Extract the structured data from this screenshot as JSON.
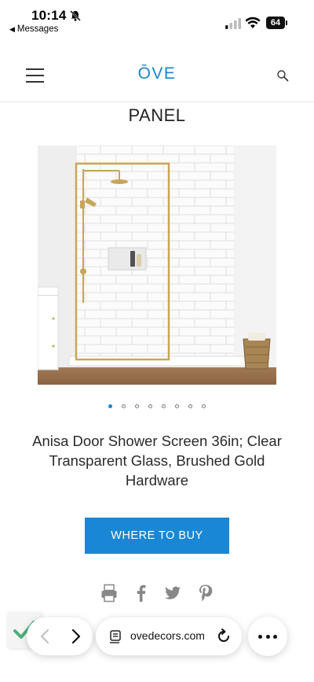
{
  "status_bar": {
    "time": "10:14",
    "back_app": "Messages",
    "battery": "64"
  },
  "header": {
    "logo": "ŌVE"
  },
  "page_title": "PANEL",
  "carousel": {
    "total_slides": 8,
    "active_index": 0
  },
  "product": {
    "name": "Anisa Door Shower Screen 36in; Clear Transparent Glass, Brushed Gold Hardware"
  },
  "buy_button_label": "WHERE TO BUY",
  "share_icons": [
    "print-icon",
    "facebook-icon",
    "twitter-icon",
    "pinterest-icon"
  ],
  "browser": {
    "url": "ovedecors.com"
  },
  "colors": {
    "accent": "#1a87d4",
    "logo": "#1a86c9",
    "check": "#4caf7a"
  }
}
